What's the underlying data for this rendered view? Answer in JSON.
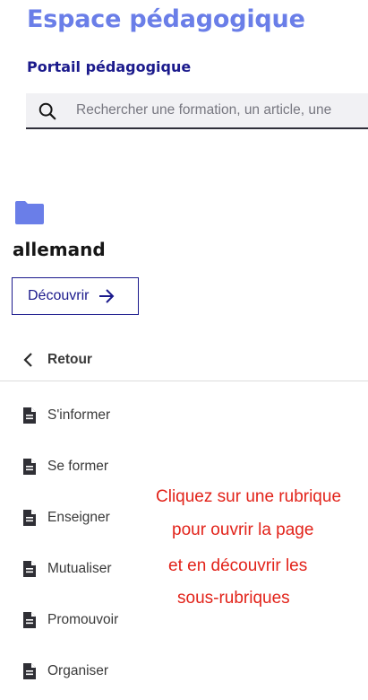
{
  "header": {
    "title": "Espace pédagogique",
    "subtitle": "Portail pédagogique"
  },
  "search": {
    "placeholder": "Rechercher une formation, un article, une",
    "icon": "search-icon"
  },
  "rubric": {
    "icon": "folder-icon",
    "icon_color": "#6a7ee8",
    "name": "allemand",
    "discover_label": "Découvrir"
  },
  "nav": {
    "back_label": "Retour",
    "items": [
      {
        "label": "S'informer"
      },
      {
        "label": "Se former"
      },
      {
        "label": "Enseigner"
      },
      {
        "label": "Mutualiser"
      },
      {
        "label": "Promouvoir"
      },
      {
        "label": "Organiser"
      }
    ]
  },
  "annotation": {
    "lines": [
      "Cliquez sur une rubrique",
      "pour ouvrir la page",
      "et en découvrir les",
      "sous-rubriques"
    ],
    "color": "#e2231a"
  },
  "colors": {
    "accent": "#6a7ee8",
    "brand_navy": "#1b1a8c"
  }
}
